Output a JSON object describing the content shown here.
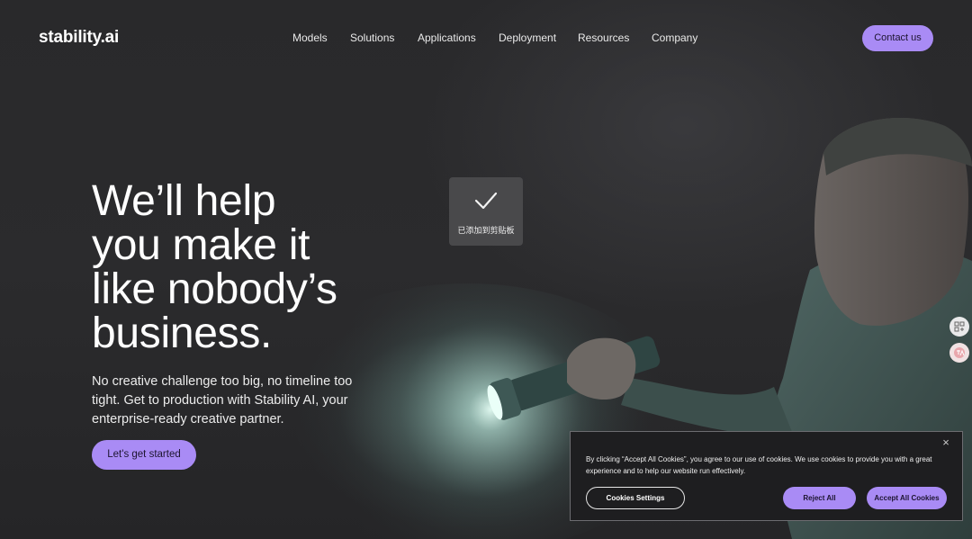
{
  "header": {
    "logo": "stability.ai",
    "nav": [
      "Models",
      "Solutions",
      "Applications",
      "Deployment",
      "Resources",
      "Company"
    ],
    "contact_label": "Contact us"
  },
  "hero": {
    "title_lines": [
      "We’ll help",
      "you make it",
      "like nobody’s",
      "business."
    ],
    "subtitle": "No creative challenge too big, no timeline too tight. Get to production with Stability AI, your enterprise-ready creative partner.",
    "cta_label": "Let's get started"
  },
  "toast": {
    "icon": "check-icon",
    "text": "已添加到剪贴板"
  },
  "side_widgets": [
    "apps-icon",
    "translate-icon"
  ],
  "cookie_banner": {
    "text": "By clicking “Accept All Cookies”, you agree to our use of cookies. We use cookies to provide you with a great experience and to help our website run effectively.",
    "close_symbol": "×",
    "settings_label": "Cookies Settings",
    "reject_label": "Reject All",
    "accept_label": "Accept All Cookies"
  },
  "colors": {
    "accent": "#a98bf5",
    "background": "#2a2a2c"
  }
}
